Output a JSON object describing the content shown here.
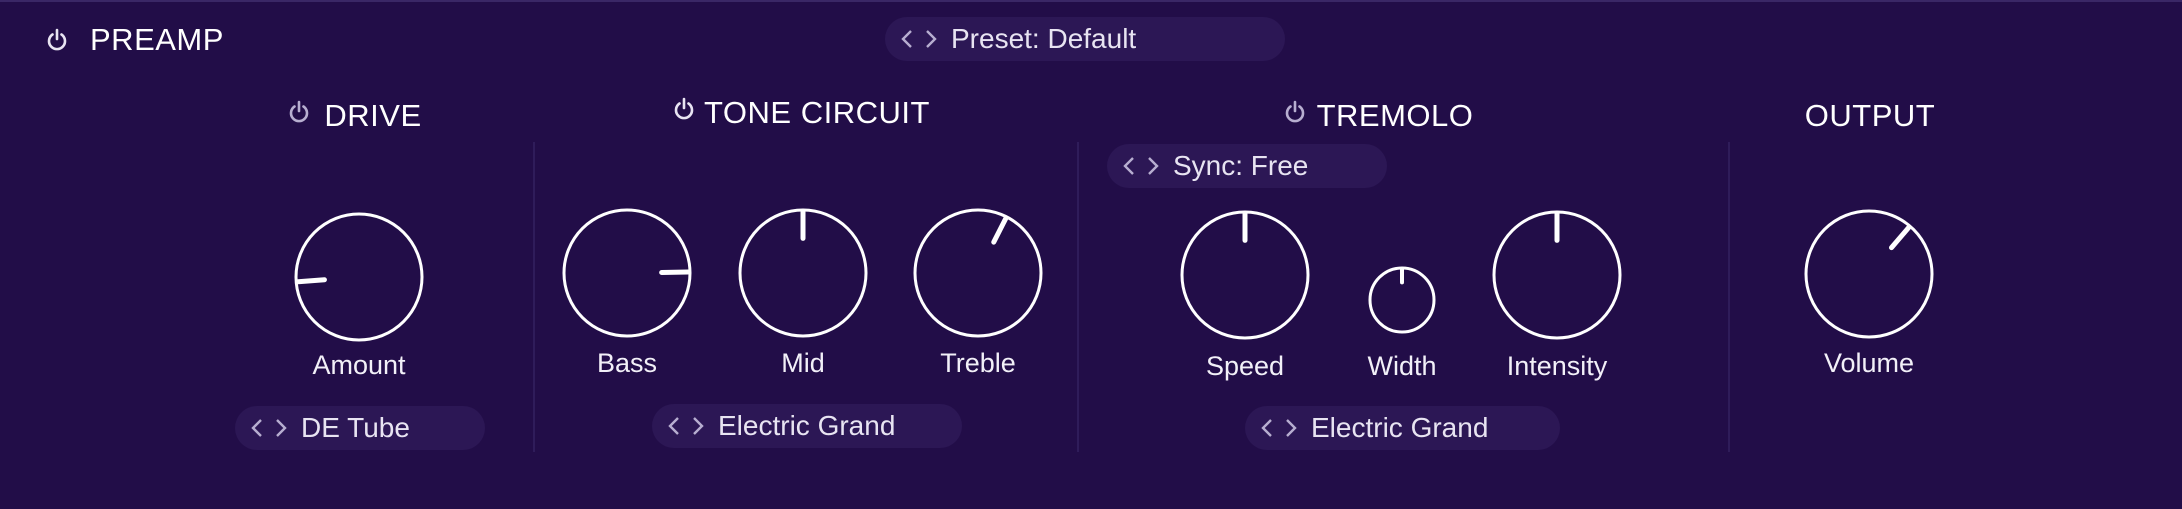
{
  "header": {
    "title": "PREAMP",
    "preset_label": "Preset: Default"
  },
  "sections": {
    "drive": {
      "title": "DRIVE",
      "knob_label": "Amount",
      "amount_position": 0.15,
      "selector_label": "DE Tube"
    },
    "tone": {
      "title": "TONE CIRCUIT",
      "bass_label": "Bass",
      "bass_position": 0.83,
      "mid_label": "Mid",
      "mid_position": 0.5,
      "treble_label": "Treble",
      "treble_position": 0.6,
      "selector_label": "Electric Grand"
    },
    "tremolo": {
      "title": "TREMOLO",
      "sync_label": "Sync: Free",
      "speed_label": "Speed",
      "speed_position": 0.5,
      "width_label": "Width",
      "width_position": 0.5,
      "intensity_label": "Intensity",
      "intensity_position": 0.5,
      "selector_label": "Electric Grand"
    },
    "output": {
      "title": "OUTPUT",
      "knob_label": "Volume",
      "volume_position": 0.65
    }
  },
  "icons": {
    "power": "power-icon",
    "arrows": "chevron-left-right-icon"
  },
  "colors": {
    "background": "#220d48",
    "selector_bg": "#2c1755",
    "knob_stroke": "#ffffff",
    "power_icon": "#b7aed0"
  }
}
